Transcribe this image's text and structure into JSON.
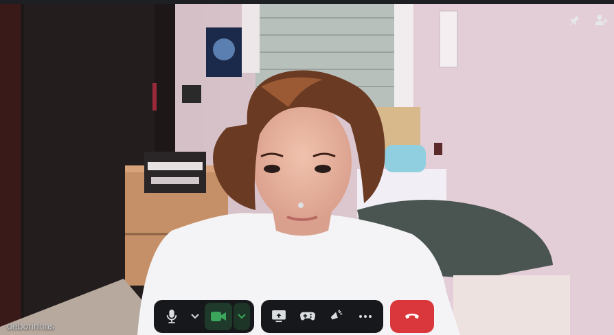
{
  "call": {
    "participant_name": "deborinhas"
  },
  "top_actions": {
    "pin_icon": "pin-icon",
    "add_user_icon": "add-user-icon"
  },
  "controls": {
    "mic_icon": "microphone-icon",
    "camera_icon": "video-camera-icon",
    "screen_share_icon": "screen-share-icon",
    "activities_icon": "gamepad-icon",
    "soundboard_icon": "soundboard-icon",
    "more_icon": "more-options-icon",
    "hangup_icon": "hang-up-icon"
  },
  "colors": {
    "camera_active": "#3ba55c",
    "hangup": "#da373c",
    "control_bg": "#17181b"
  }
}
